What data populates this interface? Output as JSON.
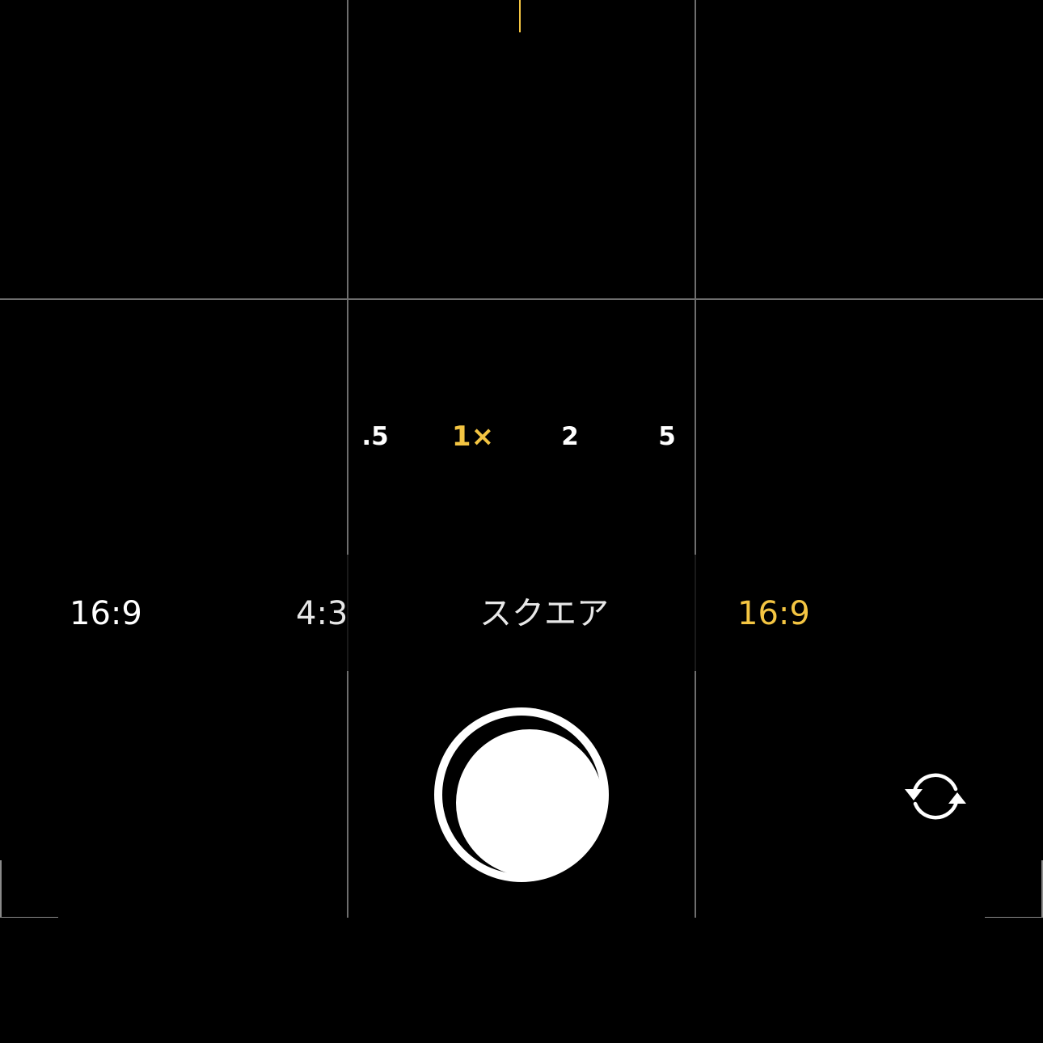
{
  "camera": {
    "zoom_options": [
      {
        "label": ".5",
        "selected": false
      },
      {
        "label": "1×",
        "selected": true
      },
      {
        "label": "2",
        "selected": false
      },
      {
        "label": "5",
        "selected": false
      }
    ],
    "aspect_modes": [
      {
        "label": "16:9",
        "selected": false
      },
      {
        "label": "4:3",
        "selected": false
      },
      {
        "label": "スクエア",
        "selected": false
      },
      {
        "label": "16:9",
        "selected": true
      }
    ],
    "icons": {
      "shutter": "shutter-button",
      "flip": "camera-flip-icon"
    },
    "colors": {
      "accent": "#f4c542",
      "text": "#ffffff",
      "grid": "#6e6e6e",
      "background": "#000000"
    }
  }
}
